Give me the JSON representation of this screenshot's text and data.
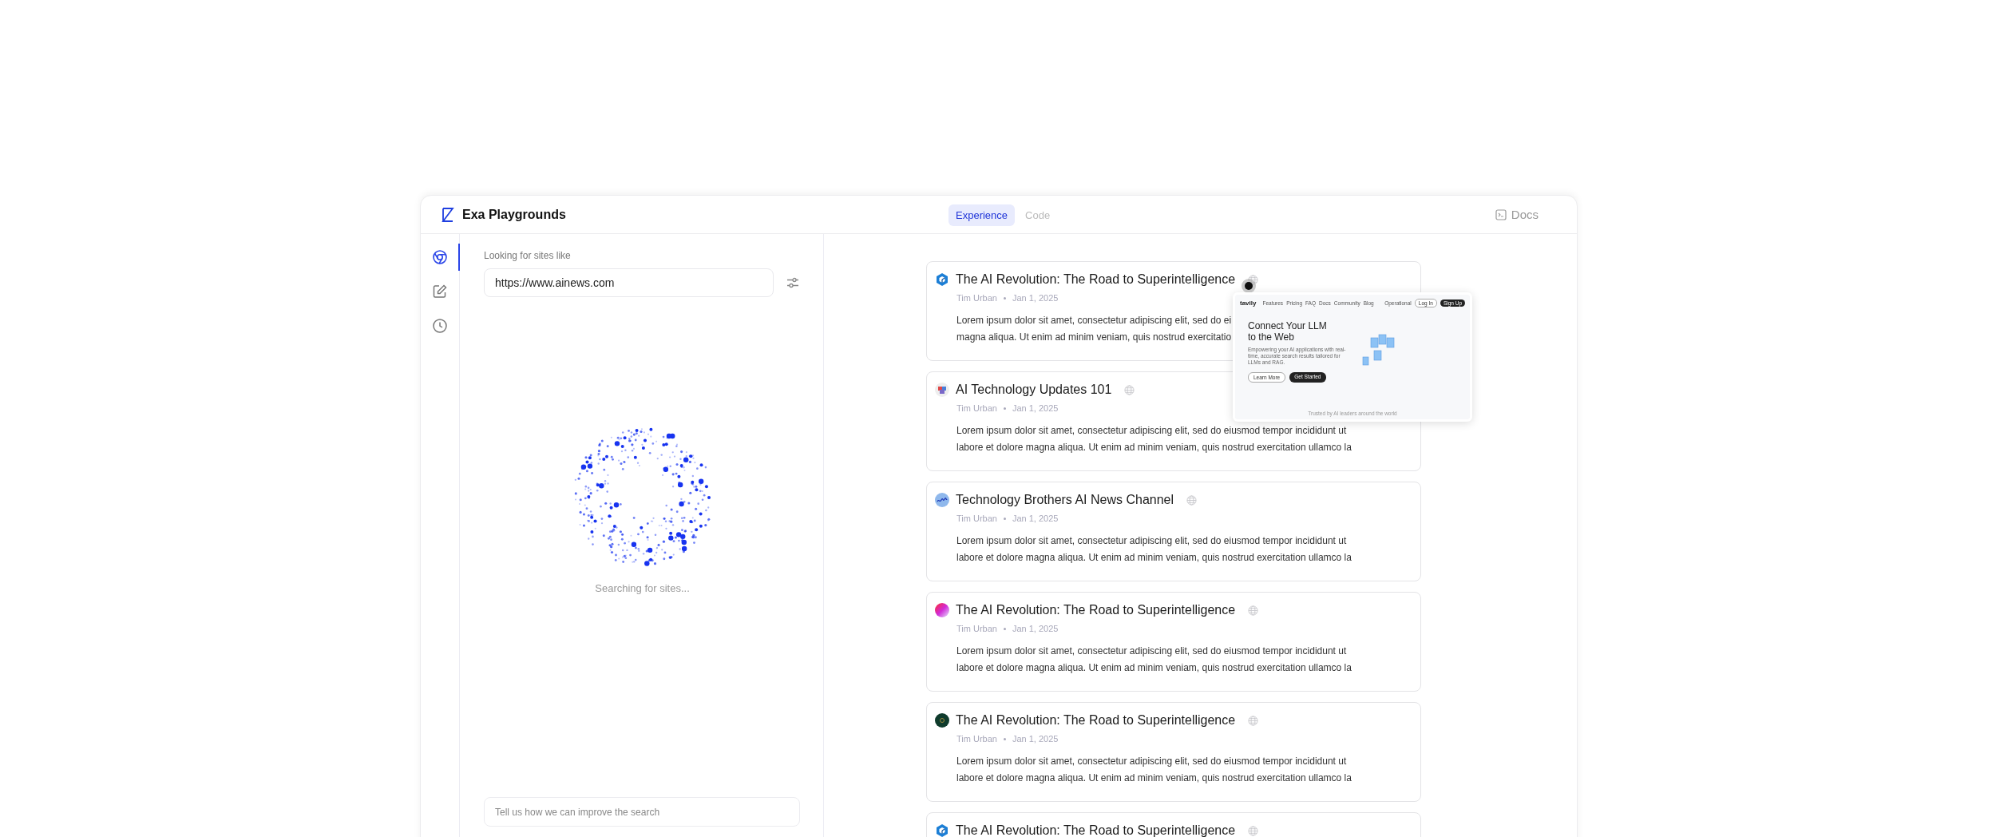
{
  "header": {
    "title": "Exa Playgrounds",
    "tabs": [
      {
        "label": "Experience",
        "selected": true
      },
      {
        "label": "Code",
        "selected": false
      }
    ],
    "docs": "Docs"
  },
  "rail": [
    {
      "kind": "chrome",
      "selected": true
    },
    {
      "kind": "edit",
      "selected": false
    },
    {
      "kind": "history",
      "selected": false
    }
  ],
  "search": {
    "label": "Looking for sites like",
    "value": "https://www.ainews.com",
    "status": "Searching for sites...",
    "feedback_placeholder": "Tell us how we can improve the search"
  },
  "results": [
    {
      "kind": "cube",
      "title": "The AI Revolution: The Road to Superintelligence",
      "author": "Tim Urban",
      "date": "Jan 1, 2025",
      "lines": [
        "Lorem ipsum dolor sit amet, consectetur adipiscing elit, sed do ei",
        "magna aliqua. Ut enim ad minim veniam, quis nostrud exercitatio"
      ]
    },
    {
      "kind": "blocks",
      "title": "AI Technology Updates 101",
      "author": "Tim Urban",
      "date": "Jan 1, 2025",
      "lines": [
        "Lorem ipsum dolor sit amet, consectetur adipiscing elit, sed do eiusmod tempor incididunt ut",
        "labore et dolore magna aliqua. Ut enim ad minim veniam, quis nostrud exercitation ullamco la"
      ]
    },
    {
      "kind": "scribble",
      "title": "Technology Brothers AI News Channel",
      "author": "Tim Urban",
      "date": "Jan 1, 2025",
      "lines": [
        "Lorem ipsum dolor sit amet, consectetur adipiscing elit, sed do eiusmod tempor incididunt ut",
        "labore et dolore magna aliqua. Ut enim ad minim veniam, quis nostrud exercitation ullamco la"
      ]
    },
    {
      "kind": "gradient",
      "title": "The AI Revolution: The Road to Superintelligence",
      "author": "Tim Urban",
      "date": "Jan 1, 2025",
      "lines": [
        "Lorem ipsum dolor sit amet, consectetur adipiscing elit, sed do eiusmod tempor incididunt ut",
        "labore et dolore magna aliqua. Ut enim ad minim veniam, quis nostrud exercitation ullamco la"
      ]
    },
    {
      "kind": "disc",
      "title": "The AI Revolution: The Road to Superintelligence",
      "author": "Tim Urban",
      "date": "Jan 1, 2025",
      "lines": [
        "Lorem ipsum dolor sit amet, consectetur adipiscing elit, sed do eiusmod tempor incididunt ut",
        "labore et dolore magna aliqua. Ut enim ad minim veniam, quis nostrud exercitation ullamco la"
      ]
    },
    {
      "kind": "cube",
      "title": "The AI Revolution: The Road to Superintelligence"
    }
  ],
  "preview": {
    "brand": "tavily",
    "nav": [
      "Features",
      "Pricing",
      "FAQ",
      "Docs",
      "Community",
      "Blog"
    ],
    "status": "Operational",
    "login": "Log In",
    "signup": "Sign Up",
    "heading": "Connect Your LLM to the Web",
    "subheading": "Empowering your AI applications with real-time, accurate search results tailored for LLMs and RAG.",
    "buttons": [
      "Learn More",
      "Get Started"
    ],
    "footer": "Trusted by AI leaders around the world"
  }
}
